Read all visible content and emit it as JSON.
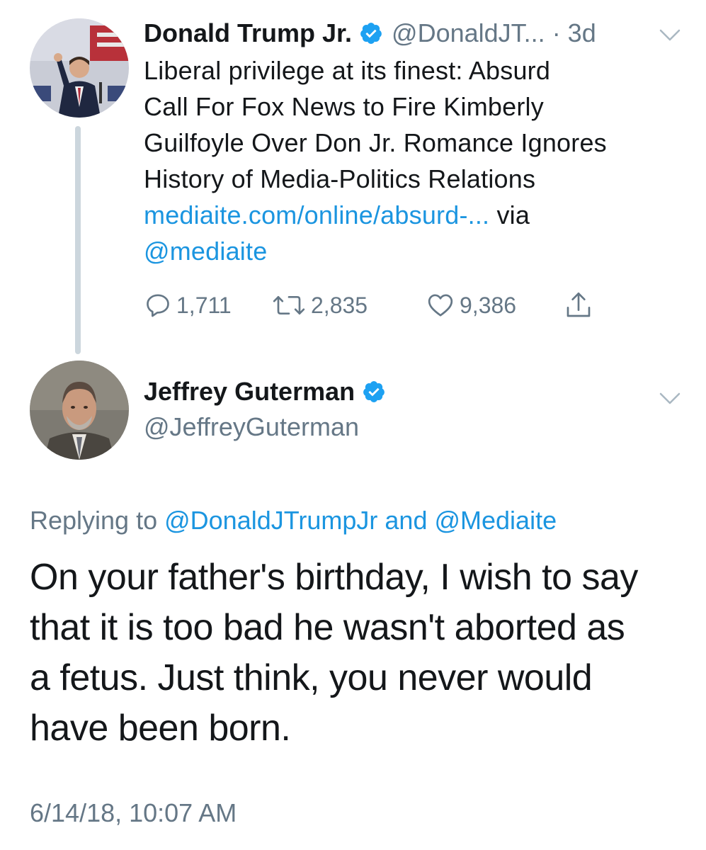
{
  "parent_tweet": {
    "author_name": "Donald Trump Jr.",
    "handle": "@DonaldJT...",
    "time": "· 3d",
    "text_line_1": "Liberal privilege at its finest: Absurd",
    "text_line_2": "Call For Fox News to Fire Kimberly",
    "text_line_3": "Guilfoyle Over Don Jr. Romance Ignores",
    "text_line_4": "History of Media-Politics Relations",
    "link_text": "mediaite.com/online/absurd-...",
    "via_text": " via",
    "via_mention": "@mediaite",
    "reply_count": "1,711",
    "retweet_count": "2,835",
    "like_count": "9,386"
  },
  "main_tweet": {
    "author_name": "Jeffrey Guterman",
    "handle": "@JeffreyGuterman",
    "replying_prefix": "Replying to ",
    "replying_mention_1": "@DonaldJTrumpJr",
    "replying_and": " and ",
    "replying_mention_2": "@Mediaite",
    "text_line_1": "On your father's birthday, I wish to say",
    "text_line_2": "that it is too bad he wasn't aborted as",
    "text_line_3": "a fetus. Just think, you never would",
    "text_line_4": "have been born.",
    "timestamp": "6/14/18, 10:07 AM"
  },
  "colors": {
    "link": "#1b95e0",
    "secondary_text": "#657786",
    "primary_text": "#14171a",
    "verified_badge": "#1da1f2",
    "thread_line": "#ccd6dd"
  },
  "icons": {
    "verified": "verified-badge-icon",
    "caret": "chevron-down-icon",
    "reply": "reply-bubble-icon",
    "retweet": "retweet-icon",
    "like": "heart-icon",
    "share": "share-icon"
  }
}
